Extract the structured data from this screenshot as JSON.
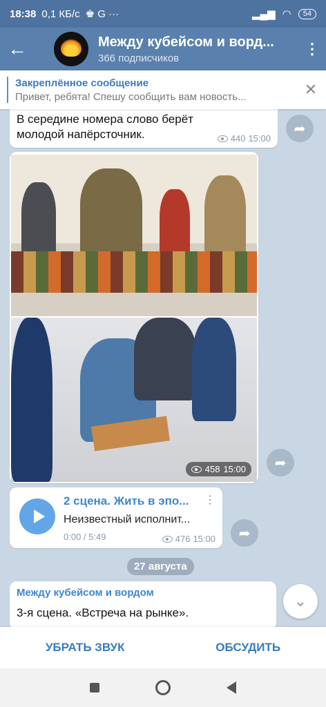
{
  "statusbar": {
    "time": "18:38",
    "speed": "0,1 КБ/с",
    "battery": "54"
  },
  "header": {
    "title": "Между кубейсом и ворд...",
    "subscribers": "366 подписчиков"
  },
  "pinned": {
    "title": "Закреплённое сообщение",
    "body": "Привет, ребята! Спешу сообщить вам новость..."
  },
  "message1": {
    "text_line1": "В середине номера слово берёт",
    "text_line2": "молодой напёрсточник.",
    "views": "440",
    "time": "15:00"
  },
  "photos": {
    "views": "458",
    "time": "15:00"
  },
  "audio": {
    "title": "2 сцена. Жить в эпо...",
    "artist": "Неизвестный исполнит...",
    "duration": "0:00 / 5:49",
    "views": "476",
    "time": "15:00"
  },
  "date_separator": "27 августа",
  "message2": {
    "sender": "Между кубейсом и вордом",
    "text": "3-я сцена. «Встреча на рынке»."
  },
  "bottom": {
    "mute": "УБРАТЬ ЗВУК",
    "discuss": "ОБСУДИТЬ"
  },
  "colors": {
    "header": "#5a80ad",
    "accent": "#3a7bbf",
    "chat_bg": "#c9d6e3"
  }
}
